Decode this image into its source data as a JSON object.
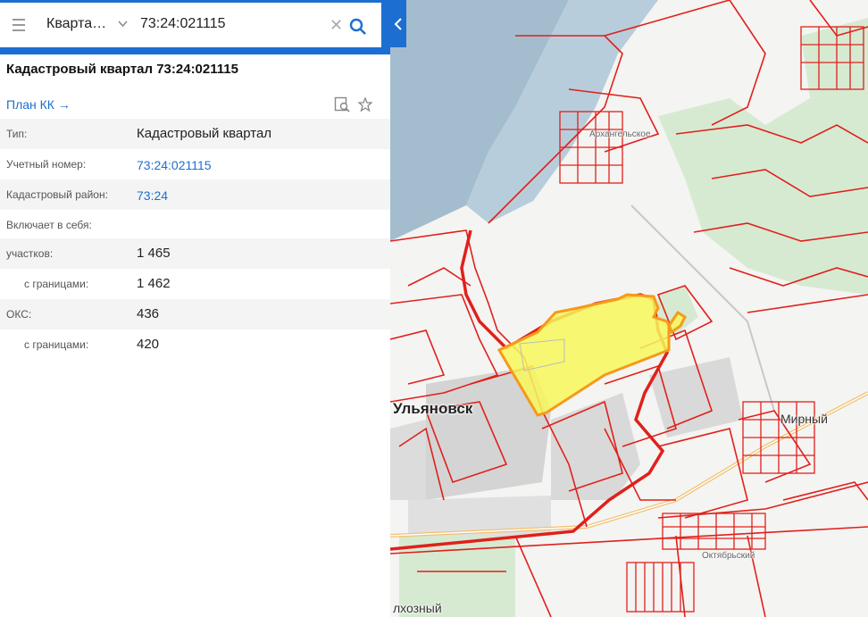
{
  "search": {
    "type_label": "Кварта…",
    "query": "73:24:021115"
  },
  "card": {
    "title": "Кадастровый квартал 73:24:021115",
    "plan_link": "План КК",
    "rows": [
      {
        "key": "Тип:",
        "value": "Кадастровый квартал"
      },
      {
        "key": "Учетный номер:",
        "value": "73:24:021115"
      },
      {
        "key": "Кадастровый район:",
        "value": "73:24"
      },
      {
        "key": "Включает в себя:",
        "value": ""
      },
      {
        "key": "участков:",
        "value": "1 465"
      },
      {
        "key": "с границами:",
        "value": "1 462"
      },
      {
        "key": "ОКС:",
        "value": "436"
      },
      {
        "key": "с границами:",
        "value": "420"
      }
    ]
  },
  "map": {
    "labels": {
      "city": "Ульяновск",
      "mirny": "Мирный",
      "arkhangelskoe": "Архангельское",
      "oktyabrsky": "Октябрьский",
      "kolkhozny": "лхозный"
    },
    "colors": {
      "water": "#a3bdcf",
      "forest": "#d6ead2",
      "boundary": "#e0201b",
      "highlight": "#f7f75a",
      "accent": "#1c6fd1"
    }
  }
}
